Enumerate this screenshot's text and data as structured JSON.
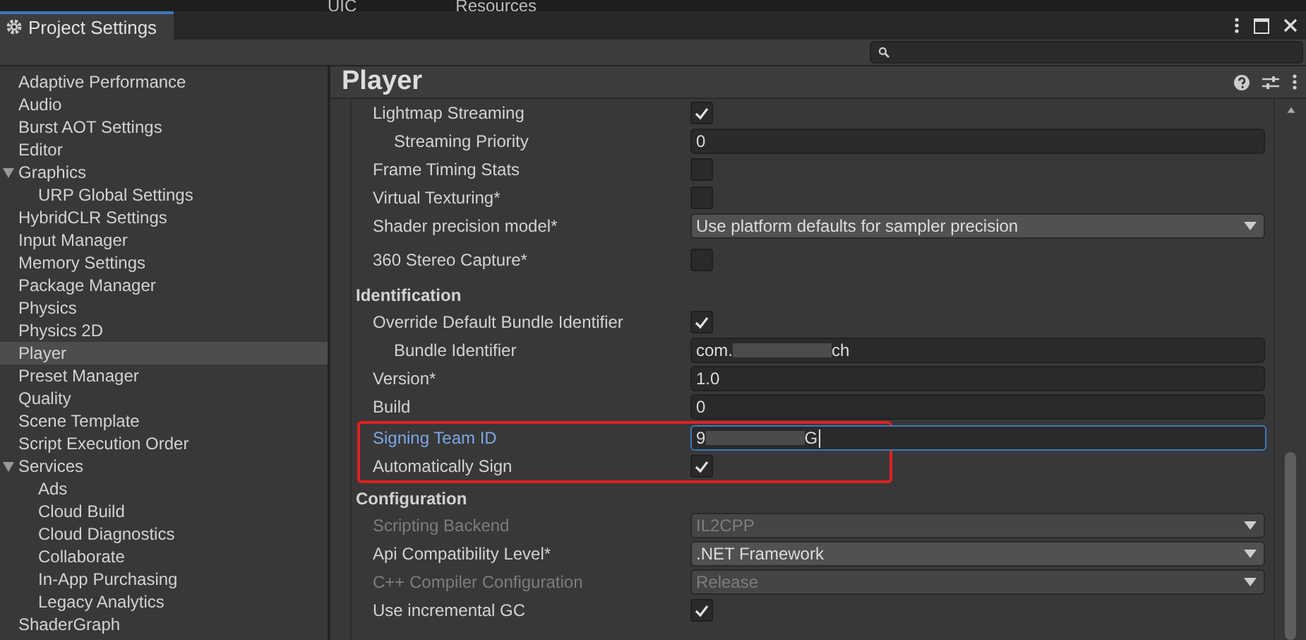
{
  "background_tabs": [
    "UIC",
    "Resources"
  ],
  "window": {
    "title": "Project Settings"
  },
  "sidebar": {
    "items": [
      {
        "label": "Adaptive Performance",
        "selected": false
      },
      {
        "label": "Audio",
        "selected": false
      },
      {
        "label": "Burst AOT Settings",
        "selected": false
      },
      {
        "label": "Editor",
        "selected": false
      },
      {
        "label": "Graphics",
        "selected": false,
        "expanded": true,
        "children": [
          {
            "label": "URP Global Settings",
            "selected": false
          }
        ]
      },
      {
        "label": "HybridCLR Settings",
        "selected": false
      },
      {
        "label": "Input Manager",
        "selected": false
      },
      {
        "label": "Memory Settings",
        "selected": false
      },
      {
        "label": "Package Manager",
        "selected": false
      },
      {
        "label": "Physics",
        "selected": false
      },
      {
        "label": "Physics 2D",
        "selected": false
      },
      {
        "label": "Player",
        "selected": true
      },
      {
        "label": "Preset Manager",
        "selected": false
      },
      {
        "label": "Quality",
        "selected": false
      },
      {
        "label": "Scene Template",
        "selected": false
      },
      {
        "label": "Script Execution Order",
        "selected": false
      },
      {
        "label": "Services",
        "selected": false,
        "expanded": true,
        "children": [
          {
            "label": "Ads",
            "selected": false
          },
          {
            "label": "Cloud Build",
            "selected": false
          },
          {
            "label": "Cloud Diagnostics",
            "selected": false
          },
          {
            "label": "Collaborate",
            "selected": false
          },
          {
            "label": "In-App Purchasing",
            "selected": false
          },
          {
            "label": "Legacy Analytics",
            "selected": false
          }
        ]
      },
      {
        "label": "ShaderGraph",
        "selected": false
      }
    ]
  },
  "panel": {
    "title": "Player",
    "sections": [
      {
        "rows": [
          {
            "kind": "check",
            "label": "Lightmap Streaming",
            "checked": true,
            "children": [
              {
                "kind": "field",
                "label": "Streaming Priority",
                "value": "0"
              }
            ]
          },
          {
            "kind": "check",
            "label": "Frame Timing Stats",
            "checked": false
          },
          {
            "kind": "check",
            "label": "Virtual Texturing*",
            "checked": false
          },
          {
            "kind": "dropdown",
            "label": "Shader precision model*",
            "value": "Use platform defaults for sampler precision"
          },
          {
            "kind": "check",
            "label": "360 Stereo Capture*",
            "checked": false
          }
        ]
      },
      {
        "title": "Identification",
        "rows": [
          {
            "kind": "check",
            "label": "Override Default Bundle Identifier",
            "checked": true,
            "children": [
              {
                "kind": "field",
                "label": "Bundle Identifier",
                "value": "com.",
                "value_end": "ch",
                "redacted": true
              }
            ]
          },
          {
            "kind": "field",
            "label": "Version*",
            "value": "1.0"
          },
          {
            "kind": "field",
            "label": "Build",
            "value": "0"
          },
          {
            "kind": "field",
            "label": "Signing Team ID",
            "value": "9",
            "value_end": "G",
            "redacted": true,
            "focused": true,
            "boxed": true
          },
          {
            "kind": "check",
            "label": "Automatically Sign",
            "checked": true,
            "boxed": true
          }
        ]
      },
      {
        "title": "Configuration",
        "rows": [
          {
            "kind": "dropdown",
            "label": "Scripting Backend",
            "value": "IL2CPP",
            "disabled": true
          },
          {
            "kind": "dropdown",
            "label": "Api Compatibility Level*",
            "value": ".NET Framework",
            "disabled": false
          },
          {
            "kind": "dropdown",
            "label": "C++ Compiler Configuration",
            "value": "Release",
            "disabled": true
          },
          {
            "kind": "check",
            "label": "Use incremental GC",
            "checked": true
          }
        ]
      }
    ]
  }
}
